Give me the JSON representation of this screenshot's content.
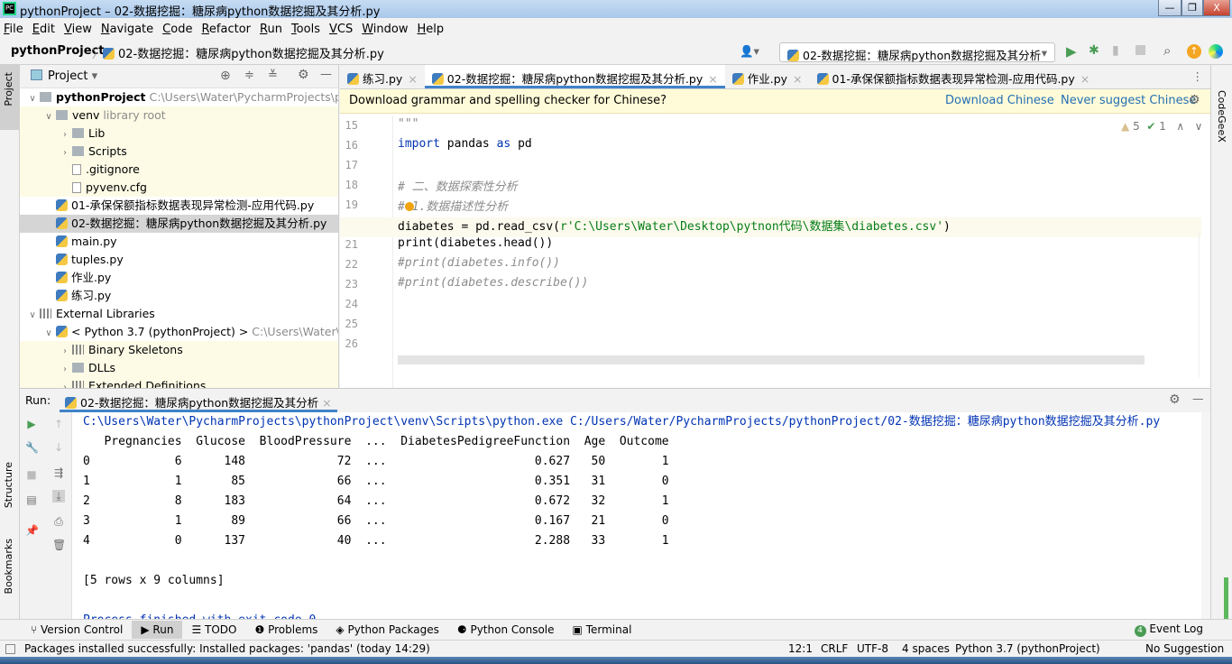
{
  "window": {
    "title": "pythonProject – 02-数据挖掘：糖尿病python数据挖掘及其分析.py",
    "min": "—",
    "max": "❐",
    "close": "X"
  },
  "menu": [
    "File",
    "Edit",
    "View",
    "Navigate",
    "Code",
    "Refactor",
    "Run",
    "Tools",
    "VCS",
    "Window",
    "Help"
  ],
  "nav": {
    "project": "pythonProject",
    "sep": "〉",
    "file": "02-数据挖掘：糖尿病python数据挖掘及其分析.py",
    "run_config": "02-数据挖掘：糖尿病python数据挖掘及其分析"
  },
  "project_panel": {
    "title": "Project",
    "vertical_tab": "Project",
    "tree": [
      {
        "label": "pythonProject",
        "hint": "C:\\Users\\Water\\PycharmProjects\\pyth",
        "depth": 0,
        "arrow": "∨",
        "icon": "folder",
        "bold": true
      },
      {
        "label": "venv",
        "hint": "library root",
        "depth": 1,
        "arrow": "∨",
        "icon": "folder"
      },
      {
        "label": "Lib",
        "depth": 2,
        "arrow": "›",
        "icon": "folder"
      },
      {
        "label": "Scripts",
        "depth": 2,
        "arrow": "›",
        "icon": "folder"
      },
      {
        "label": ".gitignore",
        "depth": 2,
        "icon": "file"
      },
      {
        "label": "pyvenv.cfg",
        "depth": 2,
        "icon": "file"
      },
      {
        "label": "01-承保保额指标数据表现异常检测-应用代码.py",
        "depth": 1,
        "icon": "python"
      },
      {
        "label": "02-数据挖掘：糖尿病python数据挖掘及其分析.py",
        "depth": 1,
        "icon": "python",
        "selected": true
      },
      {
        "label": "main.py",
        "depth": 1,
        "icon": "python"
      },
      {
        "label": "tuples.py",
        "depth": 1,
        "icon": "python"
      },
      {
        "label": "作业.py",
        "depth": 1,
        "icon": "python"
      },
      {
        "label": "练习.py",
        "depth": 1,
        "icon": "python"
      },
      {
        "label": "External Libraries",
        "depth": 0,
        "arrow": "∨",
        "icon": "library"
      },
      {
        "label": "< Python 3.7 (pythonProject) >",
        "hint": "C:\\Users\\Water\\Pyc",
        "depth": 1,
        "arrow": "∨",
        "icon": "python"
      },
      {
        "label": "Binary Skeletons",
        "depth": 2,
        "arrow": "›",
        "icon": "library"
      },
      {
        "label": "DLLs",
        "depth": 2,
        "arrow": "›",
        "icon": "folder"
      },
      {
        "label": "Extended Definitions",
        "depth": 2,
        "arrow": "›",
        "icon": "library"
      }
    ]
  },
  "tabs": [
    {
      "label": "练习.py"
    },
    {
      "label": "02-数据挖掘：糖尿病python数据挖掘及其分析.py",
      "active": true
    },
    {
      "label": "作业.py"
    },
    {
      "label": "01-承保保额指标数据表现异常检测-应用代码.py"
    }
  ],
  "banner": {
    "text": "Download grammar and spelling checker for Chinese?",
    "download": "Download Chinese",
    "never": "Never suggest Chinese"
  },
  "inspections": {
    "warnings": "5",
    "weak": "1"
  },
  "code": {
    "lines": [
      "15",
      "16",
      "17",
      "18",
      "19",
      "20",
      "21",
      "22",
      "23",
      "24",
      "25",
      "26"
    ],
    "l15": "\"\"\"",
    "l16a": "import",
    "l16b": " pandas ",
    "l16c": "as",
    "l16d": " pd",
    "l18": "# 二、数据探索性分析",
    "l19": "# 1.数据描述性分析",
    "l20a": "diabetes = pd.read_csv(",
    "l20b": "r'C:\\Users\\Water\\Desktop\\pytnon代码\\数据集\\diabetes.csv'",
    "l20c": ")",
    "l21": "print(diabetes.head())",
    "l22": "#print(diabetes.info())",
    "l23": "#print(diabetes.describe())"
  },
  "right_strip": {
    "label": "CodeGeeX"
  },
  "run": {
    "label": "Run:",
    "tab": "02-数据挖掘：糖尿病python数据挖掘及其分析",
    "console": [
      "C:\\Users\\Water\\PycharmProjects\\pythonProject\\venv\\Scripts\\python.exe C:/Users/Water/PycharmProjects/pythonProject/02-数据挖掘：糖尿病python数据挖掘及其分析.py",
      "   Pregnancies  Glucose  BloodPressure  ...  DiabetesPedigreeFunction  Age  Outcome",
      "0            6      148             72  ...                     0.627   50        1",
      "1            1       85             66  ...                     0.351   31        0",
      "2            8      183             64  ...                     0.672   32        1",
      "3            1       89             66  ...                     0.167   21        0",
      "4            0      137             40  ...                     2.288   33        1",
      "",
      "[5 rows x 9 columns]",
      "",
      "Process finished with exit code 0"
    ]
  },
  "left_vertical": {
    "structure": "Structure",
    "bookmarks": "Bookmarks"
  },
  "bottom_tools": [
    "Version Control",
    "Run",
    "TODO",
    "Problems",
    "Python Packages",
    "Python Console",
    "Terminal"
  ],
  "event_log": {
    "count": "4",
    "label": "Event Log"
  },
  "status": {
    "message": "Packages installed successfully: Installed packages: 'pandas' (today 14:29)",
    "position": "12:1",
    "line_sep": "CRLF",
    "encoding": "UTF-8",
    "indent": "4 spaces",
    "interpreter": "Python 3.7 (pythonProject)",
    "extra": "No Suggestion"
  },
  "colors": {
    "accent": "#4083c9",
    "banner": "#fffbd9",
    "run_green": "#499c54",
    "console_path": "#0033b3"
  }
}
